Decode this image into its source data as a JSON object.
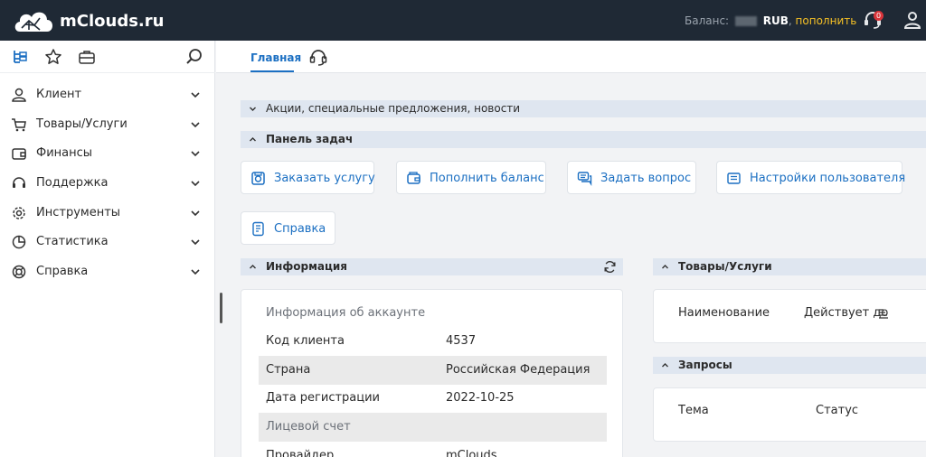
{
  "app": {
    "logo_text": "mClouds.ru"
  },
  "topbar": {
    "balance_label": "Баланс:",
    "currency": "RUB",
    "topup_label": "пополнить",
    "notifications_count": "0",
    "icons": [
      "headset-alert-icon",
      "user-icon"
    ]
  },
  "sidebar": {
    "tools": [
      "tree-icon",
      "star-icon",
      "briefcase-icon",
      "search-icon"
    ],
    "items": [
      {
        "label": "Клиент",
        "icon": "user-icon"
      },
      {
        "label": "Товары/Услуги",
        "icon": "cart-icon"
      },
      {
        "label": "Финансы",
        "icon": "wallet-icon"
      },
      {
        "label": "Поддержка",
        "icon": "headset-icon"
      },
      {
        "label": "Инструменты",
        "icon": "gear-icon"
      },
      {
        "label": "Статистика",
        "icon": "pie-chart-icon"
      },
      {
        "label": "Справка",
        "icon": "lifebuoy-icon"
      }
    ]
  },
  "tabs": {
    "main": "Главная"
  },
  "sections": {
    "news": "Акции, специальные предложения, новости",
    "tasks": "Панель задач",
    "info": "Информация",
    "products": "Товары/Услуги",
    "requests": "Запросы"
  },
  "actions": {
    "order": "Заказать услугу",
    "topup": "Пополнить баланс",
    "ask": "Задать вопрос",
    "settings": "Настройки пользователя",
    "help": "Справка"
  },
  "info": {
    "account_header": "Информация об аккаунте",
    "rows": [
      {
        "k": "Код клиента",
        "v": "4537"
      },
      {
        "k": "Страна",
        "v": "Российская Федерация"
      },
      {
        "k": "Дата регистрации",
        "v": "2022-10-25"
      },
      {
        "k": "Лицевой счет",
        "v": ""
      },
      {
        "k": "Провайдер",
        "v": "mClouds"
      }
    ]
  },
  "products_table": {
    "col_name": "Наименование",
    "col_valid": "Действует до"
  },
  "requests_table": {
    "col_topic": "Тема",
    "col_status": "Статус"
  },
  "colors": {
    "topbar": "#1f2935",
    "accent": "#1b6fc2",
    "topup": "#f5c026",
    "badge": "#d9343a",
    "section": "#dfe6f0"
  }
}
